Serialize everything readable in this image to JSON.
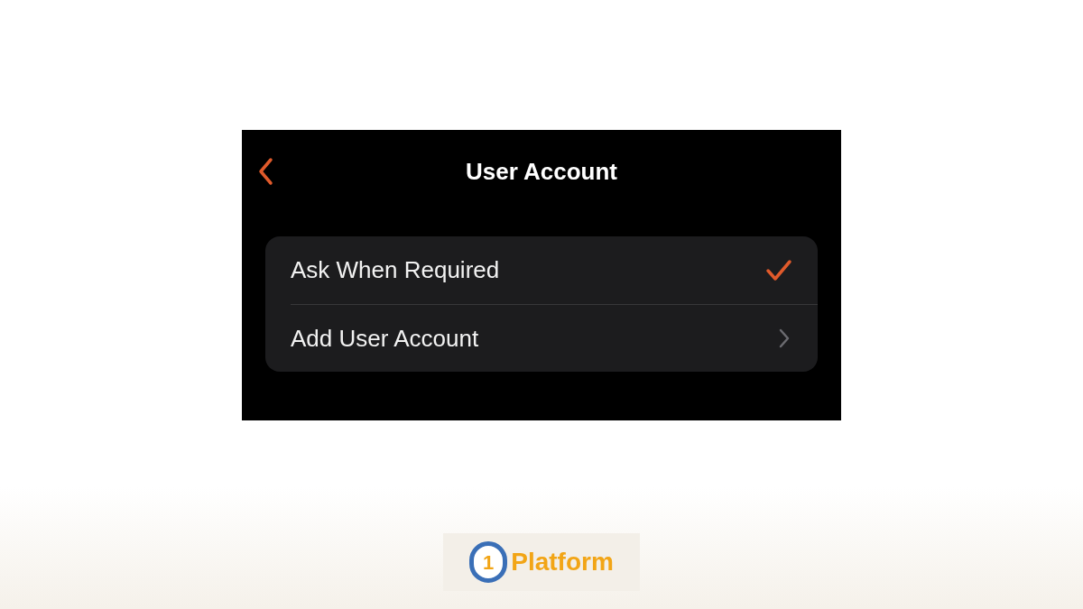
{
  "screen": {
    "title": "User Account"
  },
  "options": [
    {
      "kind": "option",
      "label": "Ask When Required",
      "selected": true
    },
    {
      "kind": "link",
      "label": "Add User Account"
    }
  ],
  "logo": {
    "badge": "1",
    "text": "Platform"
  }
}
